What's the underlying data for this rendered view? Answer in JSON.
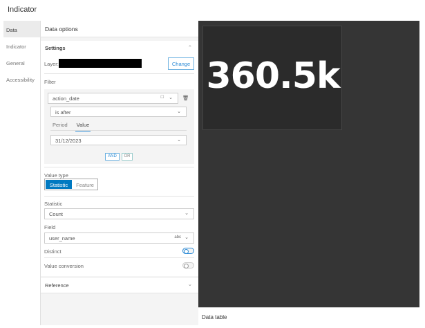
{
  "title": "Indicator",
  "nav": [
    {
      "label": "Data"
    },
    {
      "label": "Indicator"
    },
    {
      "label": "General"
    },
    {
      "label": "Accessibility"
    }
  ],
  "panel": {
    "header": "Data options",
    "settings": {
      "title": "Settings",
      "layer_label": "Layer:",
      "change_label": "Change"
    },
    "filter": {
      "label": "Filter",
      "field": "action_date",
      "operator": "is after",
      "tabs": [
        "Period",
        "Value"
      ],
      "active_tab": "Value",
      "value": "31/12/2023",
      "and_label": "AND",
      "or_label": "OR"
    },
    "value_type": {
      "label": "Value type",
      "options": [
        "Statistic",
        "Feature"
      ],
      "selected": "Statistic"
    },
    "statistic": {
      "label": "Statistic",
      "value": "Count"
    },
    "field": {
      "label": "Field",
      "value": "user_name",
      "type_badge": "abc"
    },
    "distinct": {
      "label": "Distinct",
      "on": false
    },
    "value_conversion": {
      "label": "Value conversion",
      "on": false
    },
    "reference": {
      "label": "Reference"
    }
  },
  "widget": {
    "value": "360.5k"
  },
  "data_table": {
    "label": "Data table"
  },
  "colors": {
    "accent": "#0079c1",
    "canvas": "#353535"
  }
}
